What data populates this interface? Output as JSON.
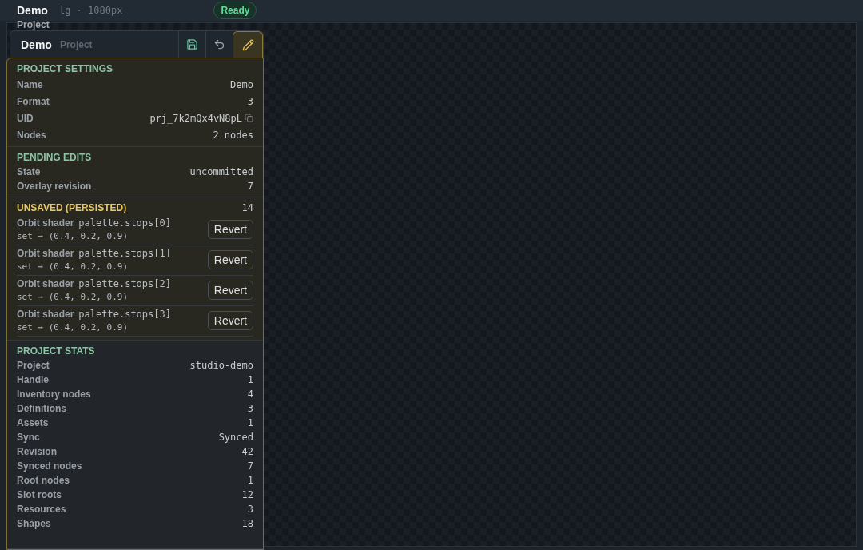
{
  "header": {
    "title": "Demo",
    "breakpoint": "lg · 1080px",
    "status": "Ready",
    "subtitle": "Project"
  },
  "toolbar": {
    "title": "Demo",
    "subtitle": "Project",
    "tools": [
      {
        "kind": "save",
        "selected": false
      },
      {
        "kind": "undo",
        "selected": false
      },
      {
        "kind": "edit",
        "selected": true
      }
    ]
  },
  "sections": [
    {
      "kind": "settings",
      "title": "PROJECT SETTINGS",
      "rows": [
        {
          "label": "Name",
          "value": "Demo"
        },
        {
          "label": "Format",
          "value": "3"
        },
        {
          "label": "UID",
          "value": "prj_7k2mQx4vN8pL",
          "copyable": true
        },
        {
          "label": "Nodes",
          "value": "2 nodes"
        }
      ]
    },
    {
      "kind": "settings",
      "title": "PENDING EDITS",
      "rows": [
        {
          "label": "State",
          "value": "uncommitted"
        },
        {
          "label": "Overlay revision",
          "value": "7"
        }
      ]
    },
    {
      "kind": "edits",
      "title": "UNSAVED (PERSISTED)",
      "count": "14",
      "edits": [
        {
          "target": "Orbit shader",
          "path": "palette.stops[0]",
          "change": "set → (0.4, 0.2, 0.9)",
          "action": "Revert"
        },
        {
          "target": "Orbit shader",
          "path": "palette.stops[1]",
          "change": "set → (0.4, 0.2, 0.9)",
          "action": "Revert"
        },
        {
          "target": "Orbit shader",
          "path": "palette.stops[2]",
          "change": "set → (0.4, 0.2, 0.9)",
          "action": "Revert"
        },
        {
          "target": "Orbit shader",
          "path": "palette.stops[3]",
          "change": "set → (0.4, 0.2, 0.9)",
          "action": "Revert"
        }
      ]
    },
    {
      "kind": "stats",
      "title": "PROJECT STATS",
      "rows": [
        {
          "label": "Project",
          "value": "studio-demo"
        },
        {
          "label": "Handle",
          "value": "1"
        },
        {
          "label": "Inventory nodes",
          "value": "4"
        },
        {
          "label": "Definitions",
          "value": "3"
        },
        {
          "label": "Assets",
          "value": "1"
        },
        {
          "label": "Sync",
          "value": "Synced"
        },
        {
          "label": "Revision",
          "value": "42"
        },
        {
          "label": "Synced nodes",
          "value": "7"
        },
        {
          "label": "Root nodes",
          "value": "1"
        },
        {
          "label": "Slot roots",
          "value": "12"
        },
        {
          "label": "Resources",
          "value": "3"
        },
        {
          "label": "Shapes",
          "value": "18"
        }
      ]
    }
  ]
}
